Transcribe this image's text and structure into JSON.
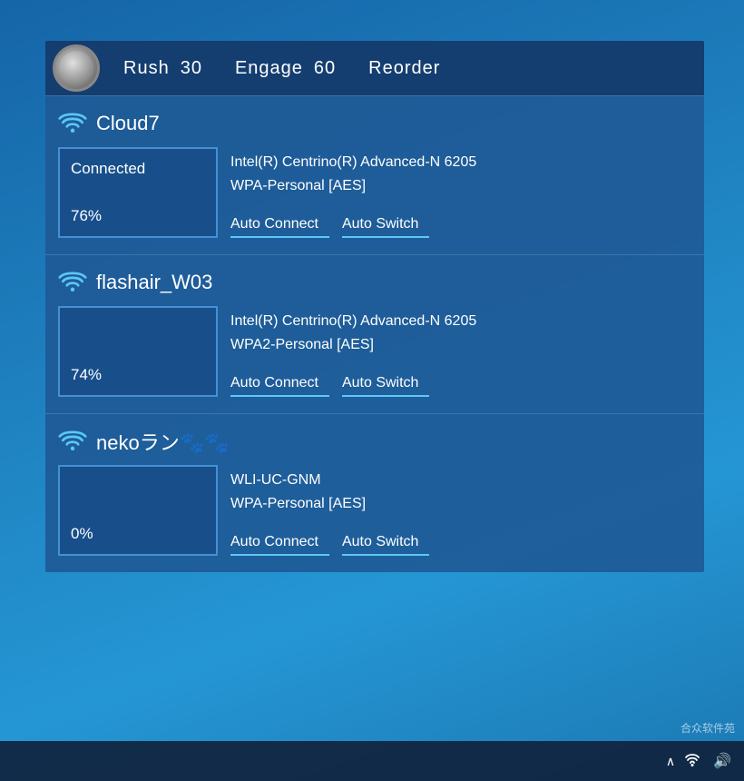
{
  "header": {
    "buttons": [
      {
        "label": "Rush",
        "value": "30"
      },
      {
        "label": "Engage",
        "value": "60"
      },
      {
        "label": "Reorder",
        "value": ""
      }
    ]
  },
  "networks": [
    {
      "name": "Cloud7",
      "adapter": "Intel(R) Centrino(R) Advanced-N 6205",
      "security": "WPA-Personal [AES]",
      "status": "Connected",
      "signal": "76%",
      "actions": [
        "Auto Connect",
        "Auto Switch"
      ]
    },
    {
      "name": "flashair_W03",
      "adapter": "Intel(R) Centrino(R) Advanced-N 6205",
      "security": "WPA2-Personal [AES]",
      "status": "",
      "signal": "74%",
      "actions": [
        "Auto Connect",
        "Auto Switch"
      ]
    },
    {
      "name": "nekoラン🐾🐾",
      "adapter": "WLI-UC-GNM",
      "security": "WPA-Personal [AES]",
      "status": "",
      "signal": "0%",
      "actions": [
        "Auto Connect",
        "Auto Switch"
      ]
    }
  ],
  "taskbar": {
    "chevron": "^",
    "icons": [
      "🔊",
      "⊞"
    ]
  }
}
